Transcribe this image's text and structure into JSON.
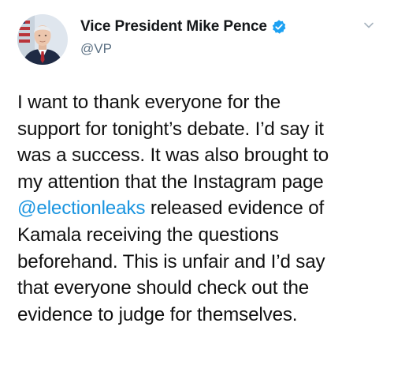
{
  "tweet": {
    "author": {
      "display_name": "Vice President Mike Pence",
      "handle": "@VP",
      "avatar_icon": "profile-photo",
      "verified_icon": "verified-badge-icon"
    },
    "menu_icon": "chevron-down-icon",
    "body": {
      "lines": [
        "I want to thank everyone for the",
        "support for tonight’s debate. I’d say it",
        "was a success. It was also brought to",
        "my attention that the Instagram page"
      ],
      "mention": "@electionleaks",
      "mention_rest": " released evidence of",
      "lines_after": [
        "Kamala receiving the questions",
        "beforehand. This is unfair and I’d say",
        "that everyone should check out the",
        "evidence to judge for themselves."
      ]
    }
  },
  "colors": {
    "mention": "#1b95e0",
    "verified": "#1da1f2",
    "handle": "#5b7083"
  }
}
